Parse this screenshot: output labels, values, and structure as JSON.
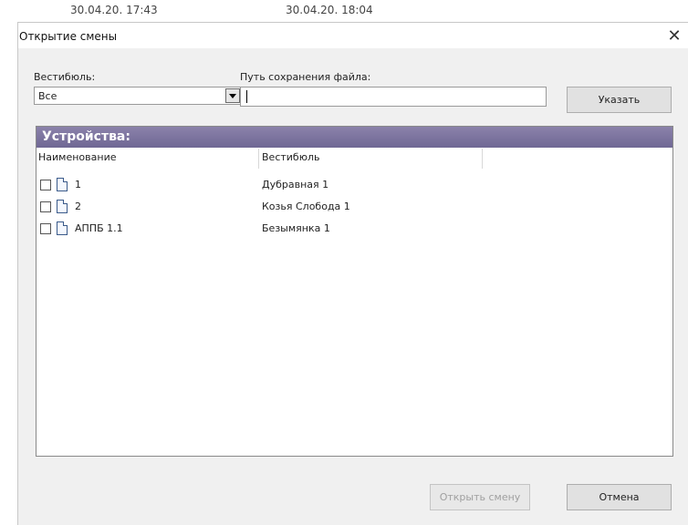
{
  "background": {
    "times": [
      "30.04.20. 17:43",
      "30.04.20. 18:04"
    ]
  },
  "dialog": {
    "title": "Открытие смены",
    "close_glyph": "✕"
  },
  "form": {
    "vestibule_label": "Вестибюль:",
    "vestibule_value": "Все",
    "path_label": "Путь сохранения файла:",
    "path_value": "",
    "browse_button": "Указать"
  },
  "devices": {
    "header": "Устройства:",
    "columns": [
      "Наименование",
      "Вестибюль"
    ],
    "rows": [
      {
        "name": "1",
        "vestibule": "Дубравная 1",
        "checked": false
      },
      {
        "name": "2",
        "vestibule": "Козья Слобода 1",
        "checked": false
      },
      {
        "name": "АППБ 1.1",
        "vestibule": "Безымянка 1",
        "checked": false
      }
    ]
  },
  "footer": {
    "open_button": "Открыть смену",
    "cancel_button": "Отмена"
  },
  "colors": {
    "panel_header": "#7a729e",
    "dialog_bg": "#f0f0f0"
  }
}
